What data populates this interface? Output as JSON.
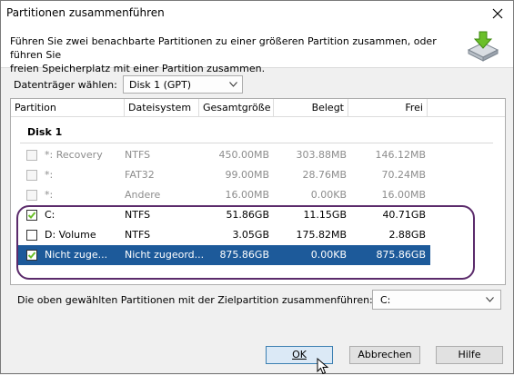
{
  "window": {
    "title": "Partitionen zusammenführen"
  },
  "header": {
    "description_line1": "Führen Sie zwei benachbarte Partitionen zu einer größeren Partition zusammen, oder führen Sie",
    "description_line2": "freien Speicherplatz mit einer Partition zusammen.",
    "icon": "merge-partition-icon"
  },
  "disk_select": {
    "label": "Datenträger wählen:",
    "value": "Disk 1 (GPT)"
  },
  "table": {
    "columns": [
      "Partition",
      "Dateisystem",
      "Gesamtgröße",
      "Belegt",
      "Frei"
    ],
    "group": "Disk 1",
    "rows": [
      {
        "name": "*: Recovery",
        "fs": "NTFS",
        "size": "450.00MB",
        "used": "303.88MB",
        "free": "146.12MB",
        "checked": false,
        "disabled": true,
        "selected": false
      },
      {
        "name": "*:",
        "fs": "FAT32",
        "size": "99.00MB",
        "used": "28.76MB",
        "free": "70.24MB",
        "checked": false,
        "disabled": true,
        "selected": false
      },
      {
        "name": "*:",
        "fs": "Andere",
        "size": "16.00MB",
        "used": "0.00KB",
        "free": "16.00MB",
        "checked": false,
        "disabled": true,
        "selected": false
      },
      {
        "name": "C:",
        "fs": "NTFS",
        "size": "51.86GB",
        "used": "11.15GB",
        "free": "40.71GB",
        "checked": true,
        "disabled": false,
        "selected": false
      },
      {
        "name": "D:  Volume",
        "fs": "NTFS",
        "size": "3.05GB",
        "used": "175.82MB",
        "free": "2.88GB",
        "checked": false,
        "disabled": false,
        "selected": false
      },
      {
        "name": "Nicht zuge...",
        "fs": "Nicht zugeord...",
        "size": "875.86GB",
        "used": "0.00KB",
        "free": "875.86GB",
        "checked": true,
        "disabled": false,
        "selected": true
      }
    ]
  },
  "merge": {
    "label": "Die oben gewählten Partitionen mit der Zielpartition zusammenführen:",
    "target": "C:"
  },
  "buttons": {
    "ok": "OK",
    "cancel": "Abbrechen",
    "help": "Hilfe"
  },
  "colors": {
    "selection": "#1d5a9a",
    "highlight_outline": "#5b2b6b",
    "icon_green": "#6bbf2a"
  }
}
